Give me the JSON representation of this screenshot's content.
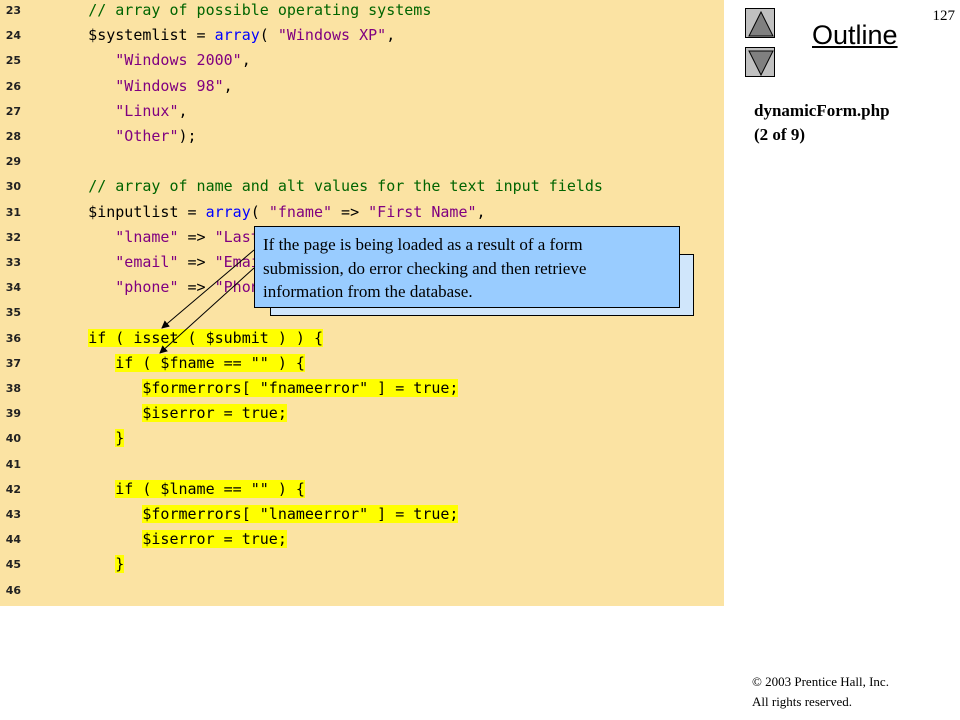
{
  "header": {
    "page_number": "127",
    "outline_title": "Outline",
    "file_title": "dynamicForm.php",
    "file_subtitle": "(2 of 9)"
  },
  "code": {
    "lines": [
      {
        "num": "23",
        "segments": [
          {
            "t": "      ",
            "s": ""
          },
          {
            "t": "// array of possible operating systems",
            "s": "cm"
          }
        ]
      },
      {
        "num": "24",
        "segments": [
          {
            "t": "      $systemlist = ",
            "s": ""
          },
          {
            "t": "array",
            "s": "kw"
          },
          {
            "t": "( ",
            "s": ""
          },
          {
            "t": "\"Windows XP\"",
            "s": "st"
          },
          {
            "t": ",",
            "s": ""
          }
        ]
      },
      {
        "num": "25",
        "segments": [
          {
            "t": "         ",
            "s": ""
          },
          {
            "t": "\"Windows 2000\"",
            "s": "st"
          },
          {
            "t": ",",
            "s": ""
          }
        ]
      },
      {
        "num": "26",
        "segments": [
          {
            "t": "         ",
            "s": ""
          },
          {
            "t": "\"Windows 98\"",
            "s": "st"
          },
          {
            "t": ",",
            "s": ""
          }
        ]
      },
      {
        "num": "27",
        "segments": [
          {
            "t": "         ",
            "s": ""
          },
          {
            "t": "\"Linux\"",
            "s": "st"
          },
          {
            "t": ",",
            "s": ""
          }
        ]
      },
      {
        "num": "28",
        "segments": [
          {
            "t": "         ",
            "s": ""
          },
          {
            "t": "\"Other\"",
            "s": "st"
          },
          {
            "t": ");",
            "s": ""
          }
        ]
      },
      {
        "num": "29",
        "segments": []
      },
      {
        "num": "30",
        "segments": [
          {
            "t": "      ",
            "s": ""
          },
          {
            "t": "// array of name and alt values for the text input fields",
            "s": "cm"
          }
        ]
      },
      {
        "num": "31",
        "segments": [
          {
            "t": "      $inputlist = ",
            "s": ""
          },
          {
            "t": "array",
            "s": "kw"
          },
          {
            "t": "( ",
            "s": ""
          },
          {
            "t": "\"fname\"",
            "s": "st"
          },
          {
            "t": " => ",
            "s": ""
          },
          {
            "t": "\"First Name\"",
            "s": "st"
          },
          {
            "t": ",",
            "s": ""
          }
        ]
      },
      {
        "num": "32",
        "segments": [
          {
            "t": "         ",
            "s": ""
          },
          {
            "t": "\"lname\"",
            "s": "st"
          },
          {
            "t": " => ",
            "s": ""
          },
          {
            "t": "\"Last",
            "s": "st"
          }
        ]
      },
      {
        "num": "33",
        "segments": [
          {
            "t": "         ",
            "s": ""
          },
          {
            "t": "\"email\"",
            "s": "st"
          },
          {
            "t": " => ",
            "s": ""
          },
          {
            "t": "\"Emai",
            "s": "st"
          }
        ]
      },
      {
        "num": "34",
        "segments": [
          {
            "t": "         ",
            "s": ""
          },
          {
            "t": "\"phone\"",
            "s": "st"
          },
          {
            "t": " => ",
            "s": ""
          },
          {
            "t": "\"Phon",
            "s": "st"
          }
        ]
      },
      {
        "num": "35",
        "segments": []
      },
      {
        "num": "36",
        "segments": [
          {
            "t": "      ",
            "s": ""
          },
          {
            "t": "if ( isset ( $submit ) ) {",
            "s": "hl"
          }
        ]
      },
      {
        "num": "37",
        "segments": [
          {
            "t": "         ",
            "s": ""
          },
          {
            "t": "if ( $fname == \"\" ) {",
            "s": "hl"
          }
        ]
      },
      {
        "num": "38",
        "segments": [
          {
            "t": "            ",
            "s": ""
          },
          {
            "t": "$formerrors[ \"fnameerror\" ] = true;",
            "s": "hl"
          }
        ]
      },
      {
        "num": "39",
        "segments": [
          {
            "t": "            ",
            "s": ""
          },
          {
            "t": "$iserror = true;",
            "s": "hl"
          }
        ]
      },
      {
        "num": "40",
        "segments": [
          {
            "t": "         ",
            "s": ""
          },
          {
            "t": "}",
            "s": "hl"
          }
        ]
      },
      {
        "num": "41",
        "segments": []
      },
      {
        "num": "42",
        "segments": [
          {
            "t": "         ",
            "s": ""
          },
          {
            "t": "if ( $lname == \"\" ) {",
            "s": "hl"
          }
        ]
      },
      {
        "num": "43",
        "segments": [
          {
            "t": "            ",
            "s": ""
          },
          {
            "t": "$formerrors[ \"lnameerror\" ] = true;",
            "s": "hl"
          }
        ]
      },
      {
        "num": "44",
        "segments": [
          {
            "t": "            ",
            "s": ""
          },
          {
            "t": "$iserror = true;",
            "s": "hl"
          }
        ]
      },
      {
        "num": "45",
        "segments": [
          {
            "t": "         ",
            "s": ""
          },
          {
            "t": "}",
            "s": "hl"
          }
        ]
      },
      {
        "num": "46",
        "segments": []
      }
    ]
  },
  "callout": {
    "text_line1": "If the page is being loaded as a result of a form",
    "text_line2": "submission, do error checking and then retrieve",
    "text_line3": "information from the database."
  },
  "nav": {
    "up_icon": "triangle-up-icon",
    "down_icon": "triangle-down-icon"
  },
  "footer": {
    "copyright_line1": "© 2003 Prentice Hall, Inc.",
    "copyright_line2": "All rights reserved."
  },
  "colors": {
    "code_background": "#fbe3a3",
    "highlight": "#ffff00",
    "callout_fill": "#99ccff",
    "comment": "#006400",
    "keyword": "#0000ff",
    "string": "#800080"
  }
}
